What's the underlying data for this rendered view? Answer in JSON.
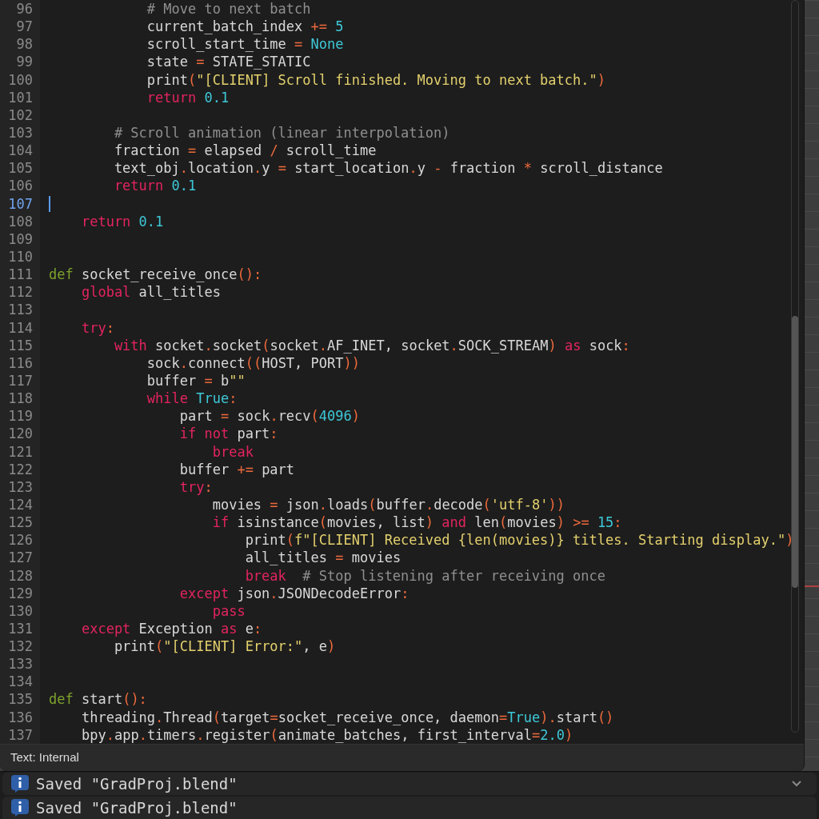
{
  "editor": {
    "lines": [
      {
        "number": "96",
        "current": false,
        "tokens": [
          {
            "kind": "comment",
            "text": "            # Move to next batch"
          }
        ]
      },
      {
        "number": "97",
        "current": false,
        "tokens": [
          {
            "kind": "plain",
            "text": "            current_batch_index "
          },
          {
            "kind": "operator",
            "text": "+="
          },
          {
            "kind": "number",
            "text": " 5"
          }
        ]
      },
      {
        "number": "98",
        "current": false,
        "tokens": [
          {
            "kind": "plain",
            "text": "            scroll_start_time "
          },
          {
            "kind": "operator",
            "text": "="
          },
          {
            "kind": "number",
            "text": " None"
          }
        ]
      },
      {
        "number": "99",
        "current": false,
        "tokens": [
          {
            "kind": "plain",
            "text": "            state "
          },
          {
            "kind": "operator",
            "text": "="
          },
          {
            "kind": "plain",
            "text": " STATE_STATIC"
          }
        ]
      },
      {
        "number": "100",
        "current": false,
        "tokens": [
          {
            "kind": "plain",
            "text": "            print"
          },
          {
            "kind": "operator",
            "text": "("
          },
          {
            "kind": "string",
            "text": "\"[CLIENT] Scroll finished. Moving to next batch.\""
          },
          {
            "kind": "operator",
            "text": ")"
          }
        ]
      },
      {
        "number": "101",
        "current": false,
        "tokens": [
          {
            "kind": "keyword",
            "text": "            return"
          },
          {
            "kind": "number",
            "text": " 0.1"
          }
        ]
      },
      {
        "number": "102",
        "current": false
      },
      {
        "number": "103",
        "current": false,
        "tokens": [
          {
            "kind": "comment",
            "text": "        # Scroll animation (linear interpolation)"
          }
        ]
      },
      {
        "number": "104",
        "current": false,
        "tokens": [
          {
            "kind": "plain",
            "text": "        fraction "
          },
          {
            "kind": "operator",
            "text": "="
          },
          {
            "kind": "plain",
            "text": " elapsed "
          },
          {
            "kind": "operator",
            "text": "/"
          },
          {
            "kind": "plain",
            "text": " scroll_time"
          }
        ]
      },
      {
        "number": "105",
        "current": false,
        "tokens": [
          {
            "kind": "plain",
            "text": "        text_obj"
          },
          {
            "kind": "operator",
            "text": "."
          },
          {
            "kind": "plain",
            "text": "location"
          },
          {
            "kind": "operator",
            "text": "."
          },
          {
            "kind": "plain",
            "text": "y "
          },
          {
            "kind": "operator",
            "text": "="
          },
          {
            "kind": "plain",
            "text": " start_location"
          },
          {
            "kind": "operator",
            "text": "."
          },
          {
            "kind": "plain",
            "text": "y "
          },
          {
            "kind": "operator",
            "text": "-"
          },
          {
            "kind": "plain",
            "text": " fraction "
          },
          {
            "kind": "operator",
            "text": "*"
          },
          {
            "kind": "plain",
            "text": " scroll_distance"
          }
        ]
      },
      {
        "number": "106",
        "current": false,
        "tokens": [
          {
            "kind": "keyword",
            "text": "        return"
          },
          {
            "kind": "number",
            "text": " 0.1"
          }
        ]
      },
      {
        "number": "107",
        "current": true
      },
      {
        "number": "108",
        "current": false,
        "tokens": [
          {
            "kind": "keyword",
            "text": "    return"
          },
          {
            "kind": "number",
            "text": " 0.1"
          }
        ]
      },
      {
        "number": "109",
        "current": false
      },
      {
        "number": "110",
        "current": false
      },
      {
        "number": "111",
        "current": false,
        "tokens": [
          {
            "kind": "def",
            "text": "def"
          },
          {
            "kind": "plain",
            "text": " socket_receive_once"
          },
          {
            "kind": "operator",
            "text": "():"
          }
        ]
      },
      {
        "number": "112",
        "current": false,
        "tokens": [
          {
            "kind": "keyword",
            "text": "    global"
          },
          {
            "kind": "plain",
            "text": " all_titles"
          }
        ]
      },
      {
        "number": "113",
        "current": false
      },
      {
        "number": "114",
        "current": false,
        "tokens": [
          {
            "kind": "keyword",
            "text": "    try"
          },
          {
            "kind": "operator",
            "text": ":"
          }
        ]
      },
      {
        "number": "115",
        "current": false,
        "tokens": [
          {
            "kind": "keyword",
            "text": "        with"
          },
          {
            "kind": "plain",
            "text": " socket"
          },
          {
            "kind": "operator",
            "text": "."
          },
          {
            "kind": "plain",
            "text": "socket"
          },
          {
            "kind": "operator",
            "text": "("
          },
          {
            "kind": "plain",
            "text": "socket"
          },
          {
            "kind": "operator",
            "text": "."
          },
          {
            "kind": "plain",
            "text": "AF_INET, socket"
          },
          {
            "kind": "operator",
            "text": "."
          },
          {
            "kind": "plain",
            "text": "SOCK_STREAM"
          },
          {
            "kind": "operator",
            "text": ")"
          },
          {
            "kind": "keyword",
            "text": " as"
          },
          {
            "kind": "plain",
            "text": " sock"
          },
          {
            "kind": "operator",
            "text": ":"
          }
        ]
      },
      {
        "number": "116",
        "current": false,
        "tokens": [
          {
            "kind": "plain",
            "text": "            sock"
          },
          {
            "kind": "operator",
            "text": "."
          },
          {
            "kind": "plain",
            "text": "connect"
          },
          {
            "kind": "operator",
            "text": "(("
          },
          {
            "kind": "plain",
            "text": "HOST, PORT"
          },
          {
            "kind": "operator",
            "text": "))"
          }
        ]
      },
      {
        "number": "117",
        "current": false,
        "tokens": [
          {
            "kind": "plain",
            "text": "            buffer "
          },
          {
            "kind": "operator",
            "text": "="
          },
          {
            "kind": "plain",
            "text": " b"
          },
          {
            "kind": "string",
            "text": "\"\""
          }
        ]
      },
      {
        "number": "118",
        "current": false,
        "tokens": [
          {
            "kind": "keyword",
            "text": "            while"
          },
          {
            "kind": "number",
            "text": " True"
          },
          {
            "kind": "operator",
            "text": ":"
          }
        ]
      },
      {
        "number": "119",
        "current": false,
        "tokens": [
          {
            "kind": "plain",
            "text": "                part "
          },
          {
            "kind": "operator",
            "text": "="
          },
          {
            "kind": "plain",
            "text": " sock"
          },
          {
            "kind": "operator",
            "text": "."
          },
          {
            "kind": "plain",
            "text": "recv"
          },
          {
            "kind": "operator",
            "text": "("
          },
          {
            "kind": "number",
            "text": "4096"
          },
          {
            "kind": "operator",
            "text": ")"
          }
        ]
      },
      {
        "number": "120",
        "current": false,
        "tokens": [
          {
            "kind": "keyword",
            "text": "                if not"
          },
          {
            "kind": "plain",
            "text": " part"
          },
          {
            "kind": "operator",
            "text": ":"
          }
        ]
      },
      {
        "number": "121",
        "current": false,
        "tokens": [
          {
            "kind": "keyword",
            "text": "                    break"
          }
        ]
      },
      {
        "number": "122",
        "current": false,
        "tokens": [
          {
            "kind": "plain",
            "text": "                buffer "
          },
          {
            "kind": "operator",
            "text": "+="
          },
          {
            "kind": "plain",
            "text": " part"
          }
        ]
      },
      {
        "number": "123",
        "current": false,
        "tokens": [
          {
            "kind": "keyword",
            "text": "                try"
          },
          {
            "kind": "operator",
            "text": ":"
          }
        ]
      },
      {
        "number": "124",
        "current": false,
        "tokens": [
          {
            "kind": "plain",
            "text": "                    movies "
          },
          {
            "kind": "operator",
            "text": "="
          },
          {
            "kind": "plain",
            "text": " json"
          },
          {
            "kind": "operator",
            "text": "."
          },
          {
            "kind": "plain",
            "text": "loads"
          },
          {
            "kind": "operator",
            "text": "("
          },
          {
            "kind": "plain",
            "text": "buffer"
          },
          {
            "kind": "operator",
            "text": "."
          },
          {
            "kind": "plain",
            "text": "decode"
          },
          {
            "kind": "operator",
            "text": "("
          },
          {
            "kind": "string",
            "text": "'utf-8'"
          },
          {
            "kind": "operator",
            "text": "))"
          }
        ]
      },
      {
        "number": "125",
        "current": false,
        "tokens": [
          {
            "kind": "keyword",
            "text": "                    if"
          },
          {
            "kind": "plain",
            "text": " isinstance"
          },
          {
            "kind": "operator",
            "text": "("
          },
          {
            "kind": "plain",
            "text": "movies, list"
          },
          {
            "kind": "operator",
            "text": ")"
          },
          {
            "kind": "keyword",
            "text": " and"
          },
          {
            "kind": "plain",
            "text": " len"
          },
          {
            "kind": "operator",
            "text": "("
          },
          {
            "kind": "plain",
            "text": "movies"
          },
          {
            "kind": "operator",
            "text": ")"
          },
          {
            "kind": "operator",
            "text": " >="
          },
          {
            "kind": "number",
            "text": " 15"
          },
          {
            "kind": "operator",
            "text": ":"
          }
        ]
      },
      {
        "number": "126",
        "current": false,
        "tokens": [
          {
            "kind": "plain",
            "text": "                        print"
          },
          {
            "kind": "operator",
            "text": "("
          },
          {
            "kind": "string",
            "text": "f\"[CLIENT] Received {len(movies)} titles. Starting display.\""
          },
          {
            "kind": "operator",
            "text": ")"
          }
        ]
      },
      {
        "number": "127",
        "current": false,
        "tokens": [
          {
            "kind": "plain",
            "text": "                        all_titles "
          },
          {
            "kind": "operator",
            "text": "="
          },
          {
            "kind": "plain",
            "text": " movies"
          }
        ]
      },
      {
        "number": "128",
        "current": false,
        "tokens": [
          {
            "kind": "keyword",
            "text": "                        break"
          },
          {
            "kind": "comment",
            "text": "  # Stop listening after receiving once"
          }
        ]
      },
      {
        "number": "129",
        "current": false,
        "tokens": [
          {
            "kind": "keyword",
            "text": "                except"
          },
          {
            "kind": "plain",
            "text": " json"
          },
          {
            "kind": "operator",
            "text": "."
          },
          {
            "kind": "plain",
            "text": "JSONDecodeError"
          },
          {
            "kind": "operator",
            "text": ":"
          }
        ]
      },
      {
        "number": "130",
        "current": false,
        "tokens": [
          {
            "kind": "keyword",
            "text": "                    pass"
          }
        ]
      },
      {
        "number": "131",
        "current": false,
        "tokens": [
          {
            "kind": "keyword",
            "text": "    except"
          },
          {
            "kind": "plain",
            "text": " Exception"
          },
          {
            "kind": "keyword",
            "text": " as"
          },
          {
            "kind": "plain",
            "text": " e"
          },
          {
            "kind": "operator",
            "text": ":"
          }
        ]
      },
      {
        "number": "132",
        "current": false,
        "tokens": [
          {
            "kind": "plain",
            "text": "        print"
          },
          {
            "kind": "operator",
            "text": "("
          },
          {
            "kind": "string",
            "text": "\"[CLIENT] Error:\""
          },
          {
            "kind": "plain",
            "text": ", e"
          },
          {
            "kind": "operator",
            "text": ")"
          }
        ]
      },
      {
        "number": "133",
        "current": false
      },
      {
        "number": "134",
        "current": false
      },
      {
        "number": "135",
        "current": false,
        "tokens": [
          {
            "kind": "def",
            "text": "def"
          },
          {
            "kind": "plain",
            "text": " start"
          },
          {
            "kind": "operator",
            "text": "():"
          }
        ]
      },
      {
        "number": "136",
        "current": false,
        "tokens": [
          {
            "kind": "plain",
            "text": "    threading"
          },
          {
            "kind": "operator",
            "text": "."
          },
          {
            "kind": "plain",
            "text": "Thread"
          },
          {
            "kind": "operator",
            "text": "("
          },
          {
            "kind": "plain",
            "text": "target"
          },
          {
            "kind": "operator",
            "text": "="
          },
          {
            "kind": "plain",
            "text": "socket_receive_once, daemon"
          },
          {
            "kind": "operator",
            "text": "="
          },
          {
            "kind": "number",
            "text": "True"
          },
          {
            "kind": "operator",
            "text": ")."
          },
          {
            "kind": "plain",
            "text": "start"
          },
          {
            "kind": "operator",
            "text": "()"
          }
        ]
      },
      {
        "number": "137",
        "current": false,
        "tokens": [
          {
            "kind": "plain",
            "text": "    bpy"
          },
          {
            "kind": "operator",
            "text": "."
          },
          {
            "kind": "plain",
            "text": "app"
          },
          {
            "kind": "operator",
            "text": "."
          },
          {
            "kind": "plain",
            "text": "timers"
          },
          {
            "kind": "operator",
            "text": "."
          },
          {
            "kind": "plain",
            "text": "register"
          },
          {
            "kind": "operator",
            "text": "("
          },
          {
            "kind": "plain",
            "text": "animate_batches, first_interval"
          },
          {
            "kind": "operator",
            "text": "="
          },
          {
            "kind": "number",
            "text": "2.0"
          },
          {
            "kind": "operator",
            "text": ")"
          }
        ]
      }
    ],
    "footer": "Text: Internal"
  },
  "reports": [
    {
      "text": "Saved \"GradProj.blend\""
    },
    {
      "text": "Saved \"GradProj.blend\""
    }
  ]
}
